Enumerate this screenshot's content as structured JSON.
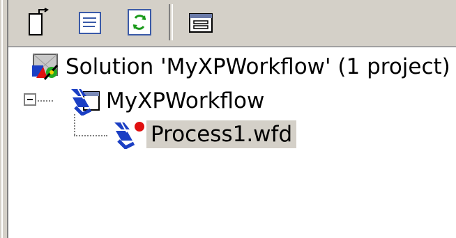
{
  "toolbar": {
    "buttons": [
      {
        "icon": "new-document-icon"
      },
      {
        "icon": "properties-icon"
      },
      {
        "icon": "refresh-icon"
      },
      {
        "icon": "view-designer-icon"
      }
    ]
  },
  "tree": {
    "solution_label": "Solution 'MyXPWorkflow' (1 project)",
    "project_label": "MyXPWorkflow",
    "file_label": "Process1.wfd",
    "selected": "Process1.wfd"
  },
  "colors": {
    "chrome": "#d4d0c8",
    "selection": "#d4d0c8",
    "icon_blue": "#1b3fc4",
    "icon_red": "#e01010"
  }
}
